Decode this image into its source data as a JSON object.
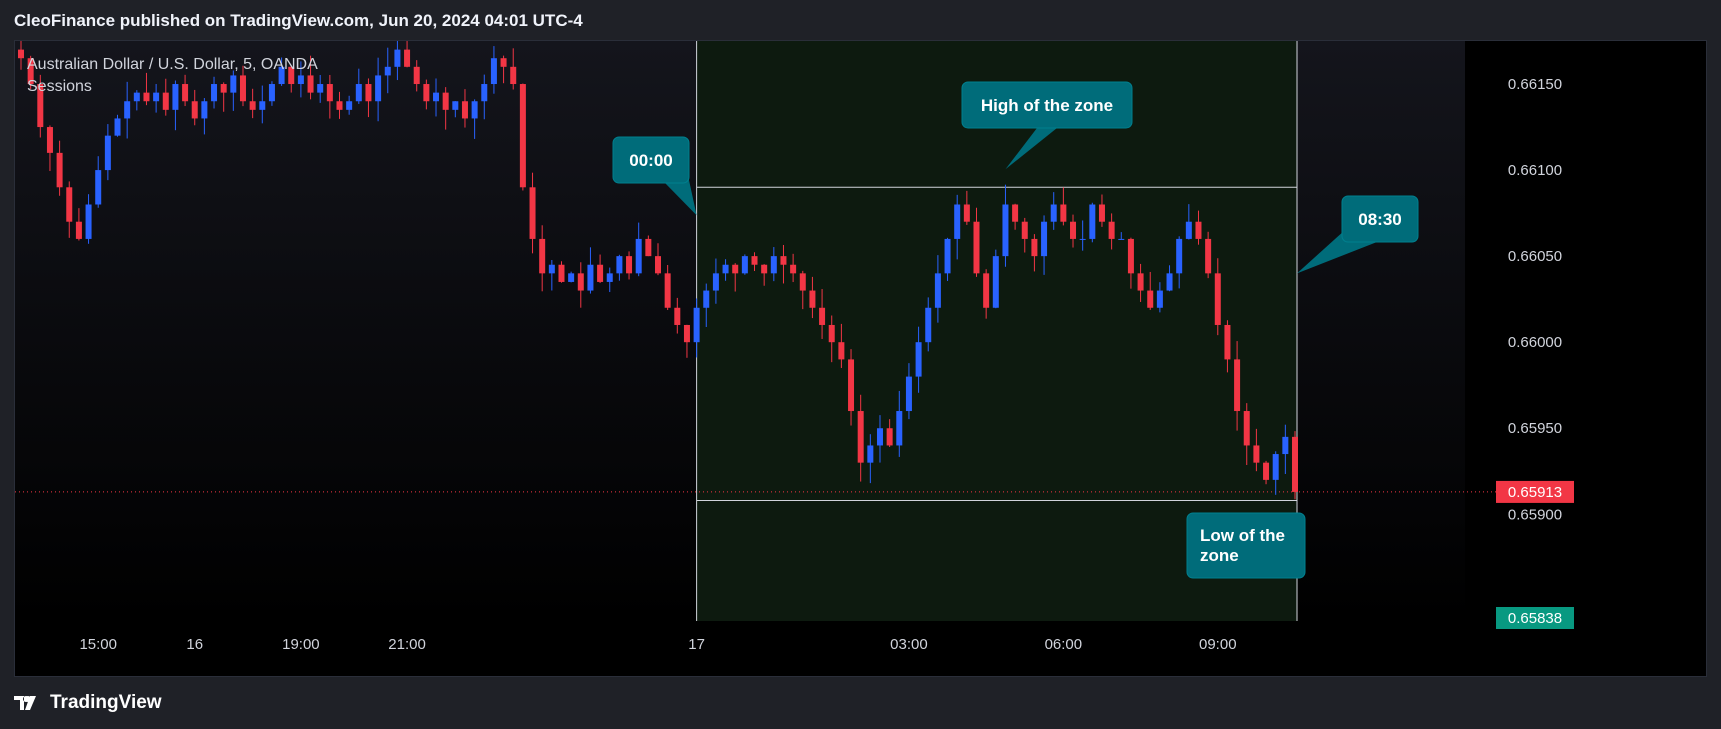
{
  "header": {
    "published": "CleoFinance published on TradingView.com, Jun 20, 2024 04:01 UTC-4"
  },
  "legend": {
    "symbol": "Australian Dollar / U.S. Dollar, 5, OANDA",
    "indicator": "Sessions"
  },
  "footer": {
    "brand": "TradingView",
    "icon": "tradingview-logo-icon"
  },
  "colors": {
    "up": "#2962ff",
    "down": "#f23645",
    "zone_fill": "#0d1a0f",
    "callout": "#006c7a",
    "price_badge_red": "#f23645",
    "price_badge_green": "#089981",
    "axis_text": "#d1d4dc"
  },
  "chart_data": {
    "type": "candlestick",
    "symbol": "Australian Dollar / U.S. Dollar",
    "interval": "5",
    "source": "OANDA",
    "x_ticks": [
      "15:00",
      "16",
      "19:00",
      "21:00",
      "17",
      "03:00",
      "06:00",
      "09:00"
    ],
    "y_ticks": [
      "0.66150",
      "0.66100",
      "0.66050",
      "0.66000",
      "0.65950",
      "0.65900"
    ],
    "ylim": [
      0.65838,
      0.66175
    ],
    "current_price": "0.65913",
    "bottom_price_label": "0.65838",
    "zone": {
      "start": "00:00",
      "end": "08:30",
      "high": 0.6609,
      "low": 0.65908
    },
    "annotations": [
      {
        "id": "start",
        "text": "00:00"
      },
      {
        "id": "high",
        "text": "High of the zone"
      },
      {
        "id": "end",
        "text": "08:30"
      },
      {
        "id": "low",
        "text": "Low of the zone"
      }
    ],
    "close_path": [
      0.66165,
      0.6615,
      0.66125,
      0.6611,
      0.6609,
      0.6607,
      0.6606,
      0.6608,
      0.661,
      0.6612,
      0.6613,
      0.6614,
      0.66145,
      0.6614,
      0.66145,
      0.66135,
      0.6615,
      0.6614,
      0.6613,
      0.6614,
      0.6615,
      0.66145,
      0.66155,
      0.6614,
      0.66135,
      0.6614,
      0.6615,
      0.6616,
      0.6615,
      0.66155,
      0.66145,
      0.6615,
      0.6614,
      0.66135,
      0.6614,
      0.6615,
      0.6614,
      0.66155,
      0.6616,
      0.6617,
      0.6616,
      0.6615,
      0.6614,
      0.66145,
      0.66135,
      0.6614,
      0.6613,
      0.6614,
      0.6615,
      0.66165,
      0.6616,
      0.6615,
      0.6609,
      0.6606,
      0.6604,
      0.66045,
      0.66035,
      0.6604,
      0.6603,
      0.66045,
      0.66035,
      0.6604,
      0.6605,
      0.6604,
      0.6606,
      0.6605,
      0.6604,
      0.6602,
      0.6601,
      0.66,
      0.6602,
      0.6603,
      0.6604,
      0.66045,
      0.6604,
      0.6605,
      0.66045,
      0.6604,
      0.6605,
      0.66045,
      0.6604,
      0.6603,
      0.6602,
      0.6601,
      0.66,
      0.6599,
      0.6596,
      0.6593,
      0.6594,
      0.6595,
      0.6594,
      0.6596,
      0.6598,
      0.66,
      0.6602,
      0.6604,
      0.6606,
      0.6608,
      0.6607,
      0.6604,
      0.6602,
      0.6605,
      0.6608,
      0.6607,
      0.6606,
      0.6605,
      0.6607,
      0.6608,
      0.6607,
      0.6606,
      0.6606,
      0.6608,
      0.6607,
      0.6606,
      0.6606,
      0.6604,
      0.6603,
      0.6602,
      0.6603,
      0.6604,
      0.6606,
      0.6607,
      0.6606,
      0.6604,
      0.6601,
      0.6599,
      0.6596,
      0.6594,
      0.6593,
      0.6592,
      0.65935,
      0.65945,
      0.65913
    ]
  }
}
